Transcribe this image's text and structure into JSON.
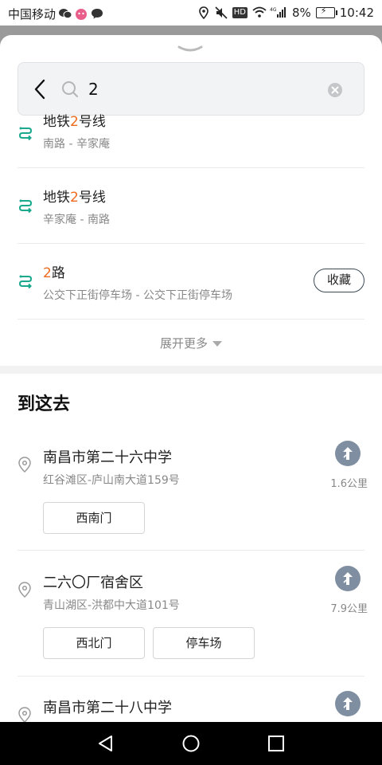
{
  "status": {
    "carrier": "中国移动",
    "battery": "8%",
    "time": "10:42",
    "network": "4G",
    "hd": "HD"
  },
  "search": {
    "query": "2"
  },
  "routes": [
    {
      "num": "地铁",
      "hl": "2",
      "tail": "号线",
      "sub": "南路 - 辛家庵"
    },
    {
      "num": "地铁",
      "hl": "2",
      "tail": "号线",
      "sub": "辛家庵 - 南路"
    },
    {
      "num": "",
      "hl": "2",
      "tail": "路",
      "sub": "公交下正街停车场 - 公交下正街停车场",
      "fav": "收藏"
    }
  ],
  "expand_label": "展开更多",
  "section_title": "到这去",
  "places": [
    {
      "name": "南昌市第二十六中学",
      "addr": "红谷滩区-庐山南大道159号",
      "dist": "1.6公里",
      "chips": [
        "西南门"
      ]
    },
    {
      "name": "二六〇厂宿舍区",
      "addr": "青山湖区-洪都中大道101号",
      "dist": "7.9公里",
      "chips": [
        "西北门",
        "停车场"
      ]
    },
    {
      "name": "南昌市第二十八中学",
      "addr": "",
      "dist": "",
      "chips": []
    }
  ],
  "colors": {
    "highlight": "#f06a1d",
    "route_icon": "#1aa98c",
    "nav_button": "#7f8ea1"
  }
}
